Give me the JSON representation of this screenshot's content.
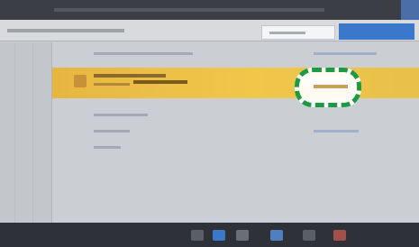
{
  "window": {
    "title": ""
  },
  "toolbar": {
    "search_placeholder": "",
    "primary_button_label": ""
  },
  "list": {
    "rows": [
      {
        "label": "",
        "value": ""
      },
      {
        "label": "",
        "value": ""
      },
      {
        "label": "",
        "value": ""
      },
      {
        "label": "",
        "value": ""
      },
      {
        "label": "",
        "value": ""
      }
    ],
    "selected_row": {
      "label": "",
      "sub_label": "",
      "value": ""
    }
  },
  "annotation": {
    "shape": "dashed-rounded-rectangle",
    "color": "#1d9a43",
    "target": "selected-row-value"
  },
  "colors": {
    "highlight": "#f1c74a",
    "accent": "#3b78c9",
    "annotation": "#1d9a43"
  },
  "taskbar": {
    "items": [
      "app-icon",
      "app-icon",
      "app-icon",
      "app-icon",
      "app-icon",
      "app-icon"
    ]
  }
}
